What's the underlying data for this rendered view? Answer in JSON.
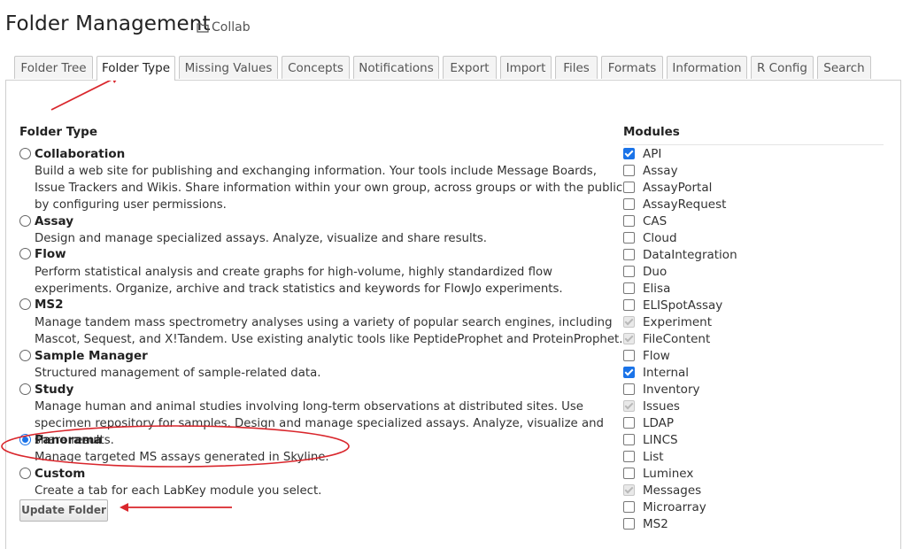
{
  "header": {
    "title": "Folder Management",
    "folder_name": "Collab"
  },
  "tabs": [
    {
      "label": "Folder Tree"
    },
    {
      "label": "Folder Type",
      "active": true
    },
    {
      "label": "Missing Values"
    },
    {
      "label": "Concepts"
    },
    {
      "label": "Notifications"
    },
    {
      "label": "Export"
    },
    {
      "label": "Import"
    },
    {
      "label": "Files"
    },
    {
      "label": "Formats"
    },
    {
      "label": "Information"
    },
    {
      "label": "R Config"
    },
    {
      "label": "Search"
    }
  ],
  "folder_type": {
    "heading": "Folder Type",
    "selected": "Panorama",
    "options": [
      {
        "name": "Collaboration",
        "desc": "Build a web site for publishing and exchanging information. Your tools include Message Boards, Issue Trackers and Wikis. Share information within your own group, across groups or with the public by configuring user permissions."
      },
      {
        "name": "Assay",
        "desc": "Design and manage specialized assays. Analyze, visualize and share results."
      },
      {
        "name": "Flow",
        "desc": "Perform statistical analysis and create graphs for high-volume, highly standardized flow experiments. Organize, archive and track statistics and keywords for FlowJo experiments."
      },
      {
        "name": "MS2",
        "desc": "Manage tandem mass spectrometry analyses using a variety of popular search engines, including Mascot, Sequest, and X!Tandem. Use existing analytic tools like PeptideProphet and ProteinProphet."
      },
      {
        "name": "Sample Manager",
        "desc": "Structured management of sample-related data."
      },
      {
        "name": "Study",
        "desc": "Manage human and animal studies involving long-term observations at distributed sites. Use specimen repository for samples. Design and manage specialized assays. Analyze, visualize and share results."
      },
      {
        "name": "Panorama",
        "desc": "Manage targeted MS assays generated in Skyline."
      },
      {
        "name": "Custom",
        "desc": "Create a tab for each LabKey module you select."
      }
    ],
    "update_button": "Update Folder"
  },
  "modules": {
    "heading": "Modules",
    "items": [
      {
        "name": "API",
        "state": "checked"
      },
      {
        "name": "Assay",
        "state": "unchecked"
      },
      {
        "name": "AssayPortal",
        "state": "unchecked"
      },
      {
        "name": "AssayRequest",
        "state": "unchecked"
      },
      {
        "name": "CAS",
        "state": "unchecked"
      },
      {
        "name": "Cloud",
        "state": "unchecked"
      },
      {
        "name": "DataIntegration",
        "state": "unchecked"
      },
      {
        "name": "Duo",
        "state": "unchecked"
      },
      {
        "name": "Elisa",
        "state": "unchecked"
      },
      {
        "name": "ELISpotAssay",
        "state": "unchecked"
      },
      {
        "name": "Experiment",
        "state": "disabled"
      },
      {
        "name": "FileContent",
        "state": "disabled"
      },
      {
        "name": "Flow",
        "state": "unchecked"
      },
      {
        "name": "Internal",
        "state": "checked"
      },
      {
        "name": "Inventory",
        "state": "unchecked"
      },
      {
        "name": "Issues",
        "state": "disabled"
      },
      {
        "name": "LDAP",
        "state": "unchecked"
      },
      {
        "name": "LINCS",
        "state": "unchecked"
      },
      {
        "name": "List",
        "state": "unchecked"
      },
      {
        "name": "Luminex",
        "state": "unchecked"
      },
      {
        "name": "Messages",
        "state": "disabled"
      },
      {
        "name": "Microarray",
        "state": "unchecked"
      },
      {
        "name": "MS2",
        "state": "unchecked"
      }
    ]
  },
  "annotation_color": "#d9262c",
  "accent_color": "#1a73e8"
}
